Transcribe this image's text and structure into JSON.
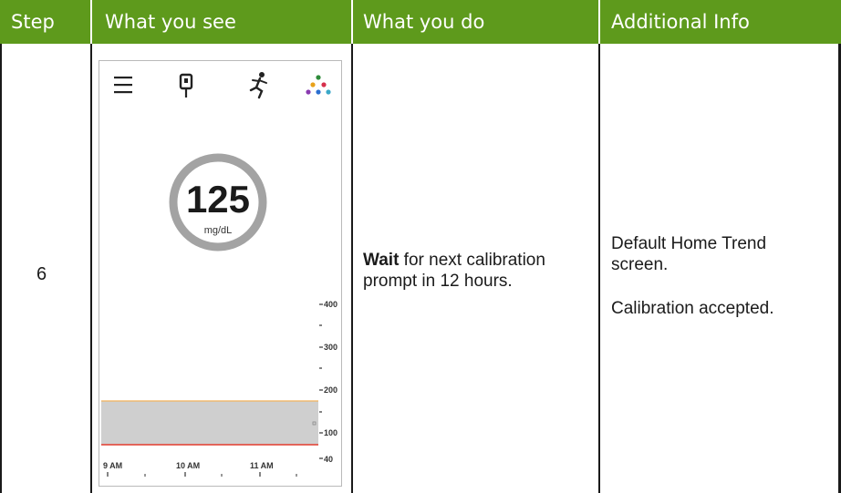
{
  "table": {
    "headers": [
      "Step",
      "What you see",
      "What you do",
      "Additional Info"
    ],
    "row": {
      "step": "6",
      "action_bold": "Wait",
      "action_rest": " for next calibration prompt in 12 hours.",
      "info_line1": "Default Home Trend screen.",
      "info_line2": "Calibration accepted."
    }
  },
  "phone_screen": {
    "toolbar_icons": [
      "menu-icon",
      "blood-drop-meter-icon",
      "running-person-icon",
      "dots-cluster-icon"
    ],
    "glucose_value": "125",
    "glucose_unit": "mg/dL",
    "y_ticks": [
      "400",
      "300",
      "200",
      "100",
      "40"
    ],
    "x_ticks": [
      "9 AM",
      "10 AM",
      "11 AM"
    ],
    "high_line_color": "#f2b25c",
    "low_line_color": "#e23b2e",
    "target_band_color": "#cfcfcf"
  },
  "colors": {
    "header_bg": "#5e9a1c",
    "header_text": "#ffffff"
  }
}
